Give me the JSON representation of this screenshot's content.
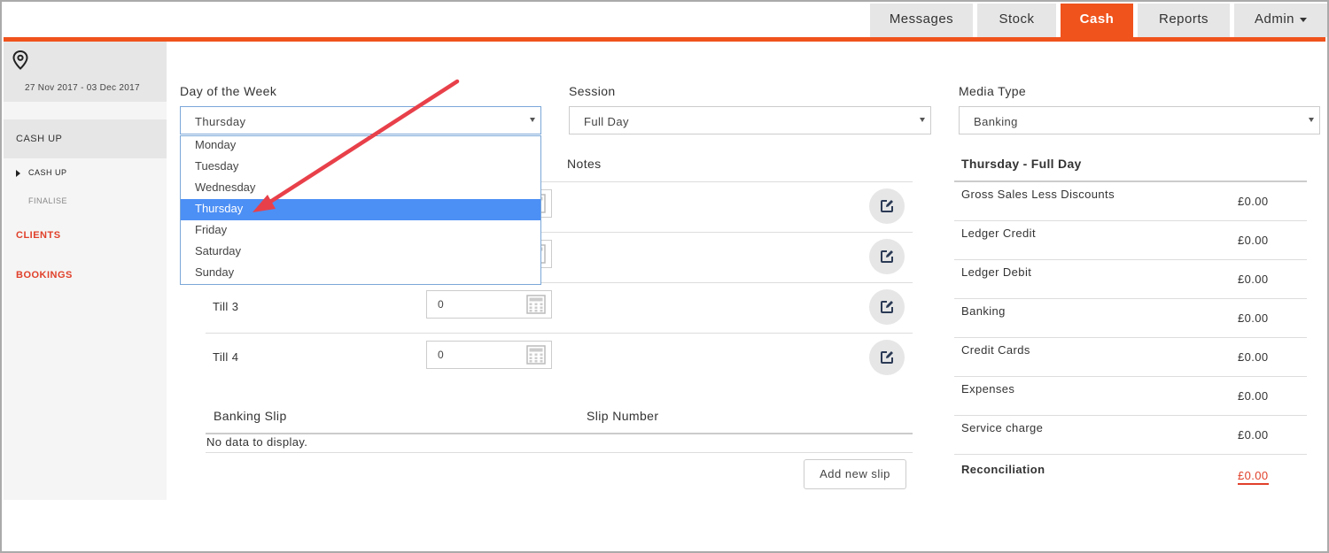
{
  "nav": {
    "tabs": [
      {
        "label": "Messages"
      },
      {
        "label": "Stock"
      },
      {
        "label": "Cash"
      },
      {
        "label": "Reports"
      },
      {
        "label": "Admin"
      }
    ],
    "active": "Cash",
    "accent_color": "#f0531c"
  },
  "sidebar": {
    "location_icon": "map-pin-icon",
    "date_range": "27 Nov 2017 - 03 Dec 2017",
    "section": "CASH UP",
    "sub_items": [
      {
        "label": "CASH UP",
        "current": true
      },
      {
        "label": "FINALISE",
        "current": false
      }
    ],
    "links": [
      {
        "label": "CLIENTS"
      },
      {
        "label": "BOOKINGS"
      }
    ]
  },
  "filters": {
    "day": {
      "label": "Day of the Week",
      "value": "Thursday"
    },
    "session": {
      "label": "Session",
      "value": "Full Day"
    },
    "media": {
      "label": "Media Type",
      "value": "Banking"
    }
  },
  "day_dropdown": {
    "options": [
      "Monday",
      "Tuesday",
      "Wednesday",
      "Thursday",
      "Friday",
      "Saturday",
      "Sunday"
    ],
    "highlighted": "Thursday"
  },
  "tills": {
    "notes_header": "Notes",
    "rows": [
      {
        "label": "Till 3",
        "value": "0"
      },
      {
        "label": "Till 4",
        "value": "0"
      }
    ]
  },
  "banking_slip": {
    "col_slip": "Banking Slip",
    "col_number": "Slip Number",
    "empty_text": "No data to display.",
    "add_button": "Add new slip"
  },
  "summary": {
    "title": "Thursday - Full Day",
    "rows": [
      {
        "label": "Gross Sales Less Discounts",
        "amount": "£0.00"
      },
      {
        "label": "Ledger Credit",
        "amount": "£0.00"
      },
      {
        "label": "Ledger Debit",
        "amount": "£0.00"
      },
      {
        "label": "Banking",
        "amount": "£0.00"
      },
      {
        "label": "Credit Cards",
        "amount": "£0.00"
      },
      {
        "label": "Expenses",
        "amount": "£0.00"
      },
      {
        "label": "Service charge",
        "amount": "£0.00"
      }
    ],
    "reconciliation_label": "Reconciliation",
    "reconciliation_amount": "£0.00"
  }
}
